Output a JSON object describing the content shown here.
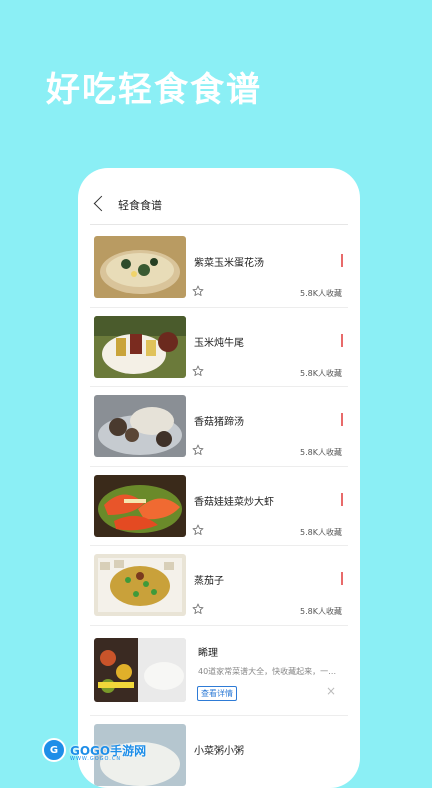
{
  "hero": {
    "title": "好吃轻食食谱"
  },
  "topbar": {
    "title": "轻食食谱"
  },
  "recipes": [
    {
      "title": "紫菜玉米蛋花汤",
      "count": "5.8K人收藏"
    },
    {
      "title": "玉米炖牛尾",
      "count": "5.8K人收藏"
    },
    {
      "title": "香菇猪蹄汤",
      "count": "5.8K人收藏"
    },
    {
      "title": "香菇娃娃菜炒大虾",
      "count": "5.8K人收藏"
    },
    {
      "title": "蒸茄子",
      "count": "5.8K人收藏"
    }
  ],
  "ad": {
    "title": "睎理",
    "desc": "40道家常菜谱大全，快收藏起来，一…",
    "button": "查看详情",
    "close": "×"
  },
  "partial": {
    "title": "小菜粥小粥"
  },
  "watermark": {
    "brand": "GOGO手游网",
    "url": "WWW.GOGO.CN"
  },
  "colors": {
    "background": "#8beff5",
    "mark": "#e86a6a",
    "link": "#2e7bd6"
  },
  "icons": {
    "back": "chevron-left-icon",
    "favorite": "star-outline-icon"
  }
}
